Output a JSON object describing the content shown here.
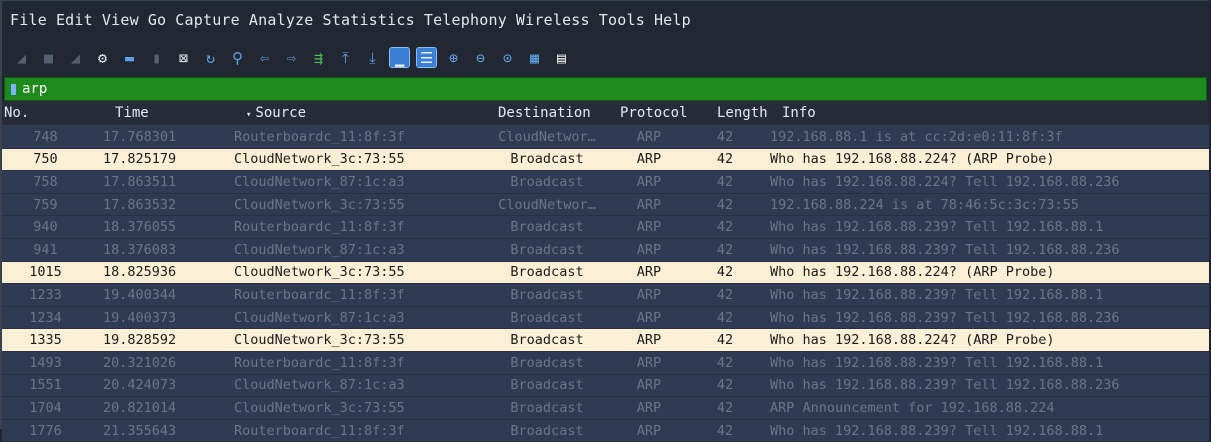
{
  "menu": [
    "File",
    "Edit",
    "View",
    "Go",
    "Capture",
    "Analyze",
    "Statistics",
    "Telephony",
    "Wireless",
    "Tools",
    "Help"
  ],
  "toolbar_icons": [
    "shark-fin-start-icon",
    "stop-square-icon",
    "shark-fin-restart-icon",
    "capture-options-gear-icon",
    "open-folder-icon",
    "save-file-icon",
    "close-file-icon",
    "reload-icon",
    "find-magnifier-icon",
    "go-back-arrow-icon",
    "go-forward-arrow-icon",
    "go-to-packet-icon",
    "first-packet-icon",
    "last-packet-icon",
    "autoscroll-icon",
    "colorize-icon",
    "zoom-in-icon",
    "zoom-out-icon",
    "zoom-normal-icon",
    "resize-columns-icon",
    "layout-icon"
  ],
  "filter": {
    "value": "arp"
  },
  "columns": {
    "no": "No.",
    "time": "Time",
    "source": "Source",
    "destination": "Destination",
    "protocol": "Protocol",
    "length": "Length",
    "info": "Info"
  },
  "packets": [
    {
      "no": "748",
      "time": "17.768301",
      "source": "Routerboardc_11:8f:3f",
      "destination": "CloudNetwor…",
      "protocol": "ARP",
      "length": "42",
      "info": "192.168.88.1 is at cc:2d:e0:11:8f:3f",
      "highlighted": false
    },
    {
      "no": "750",
      "time": "17.825179",
      "source": "CloudNetwork_3c:73:55",
      "destination": "Broadcast",
      "protocol": "ARP",
      "length": "42",
      "info": "Who has 192.168.88.224? (ARP Probe)",
      "highlighted": true
    },
    {
      "no": "758",
      "time": "17.863511",
      "source": "CloudNetwork_87:1c:a3",
      "destination": "Broadcast",
      "protocol": "ARP",
      "length": "42",
      "info": "Who has 192.168.88.224? Tell 192.168.88.236",
      "highlighted": false
    },
    {
      "no": "759",
      "time": "17.863532",
      "source": "CloudNetwork_3c:73:55",
      "destination": "CloudNetwor…",
      "protocol": "ARP",
      "length": "42",
      "info": "192.168.88.224 is at 78:46:5c:3c:73:55",
      "highlighted": false
    },
    {
      "no": "940",
      "time": "18.376055",
      "source": "Routerboardc_11:8f:3f",
      "destination": "Broadcast",
      "protocol": "ARP",
      "length": "42",
      "info": "Who has 192.168.88.239? Tell 192.168.88.1",
      "highlighted": false
    },
    {
      "no": "941",
      "time": "18.376083",
      "source": "CloudNetwork_87:1c:a3",
      "destination": "Broadcast",
      "protocol": "ARP",
      "length": "42",
      "info": "Who has 192.168.88.239? Tell 192.168.88.236",
      "highlighted": false
    },
    {
      "no": "1015",
      "time": "18.825936",
      "source": "CloudNetwork_3c:73:55",
      "destination": "Broadcast",
      "protocol": "ARP",
      "length": "42",
      "info": "Who has 192.168.88.224? (ARP Probe)",
      "highlighted": true
    },
    {
      "no": "1233",
      "time": "19.400344",
      "source": "Routerboardc_11:8f:3f",
      "destination": "Broadcast",
      "protocol": "ARP",
      "length": "42",
      "info": "Who has 192.168.88.239? Tell 192.168.88.1",
      "highlighted": false
    },
    {
      "no": "1234",
      "time": "19.400373",
      "source": "CloudNetwork_87:1c:a3",
      "destination": "Broadcast",
      "protocol": "ARP",
      "length": "42",
      "info": "Who has 192.168.88.239? Tell 192.168.88.236",
      "highlighted": false
    },
    {
      "no": "1335",
      "time": "19.828592",
      "source": "CloudNetwork_3c:73:55",
      "destination": "Broadcast",
      "protocol": "ARP",
      "length": "42",
      "info": "Who has 192.168.88.224? (ARP Probe)",
      "highlighted": true
    },
    {
      "no": "1493",
      "time": "20.321026",
      "source": "Routerboardc_11:8f:3f",
      "destination": "Broadcast",
      "protocol": "ARP",
      "length": "42",
      "info": "Who has 192.168.88.239? Tell 192.168.88.1",
      "highlighted": false
    },
    {
      "no": "1551",
      "time": "20.424073",
      "source": "CloudNetwork_87:1c:a3",
      "destination": "Broadcast",
      "protocol": "ARP",
      "length": "42",
      "info": "Who has 192.168.88.239? Tell 192.168.88.236",
      "highlighted": false
    },
    {
      "no": "1704",
      "time": "20.821014",
      "source": "CloudNetwork_3c:73:55",
      "destination": "Broadcast",
      "protocol": "ARP",
      "length": "42",
      "info": "ARP Announcement for 192.168.88.224",
      "highlighted": false
    },
    {
      "no": "1776",
      "time": "21.355643",
      "source": "Routerboardc_11:8f:3f",
      "destination": "Broadcast",
      "protocol": "ARP",
      "length": "42",
      "info": "Who has 192.168.88.239? Tell 192.168.88.1",
      "highlighted": false
    }
  ],
  "colors": {
    "highlight_row": "#fbefd6",
    "normal_row": "#2f3b52",
    "filter_valid": "#1c8a1c"
  }
}
